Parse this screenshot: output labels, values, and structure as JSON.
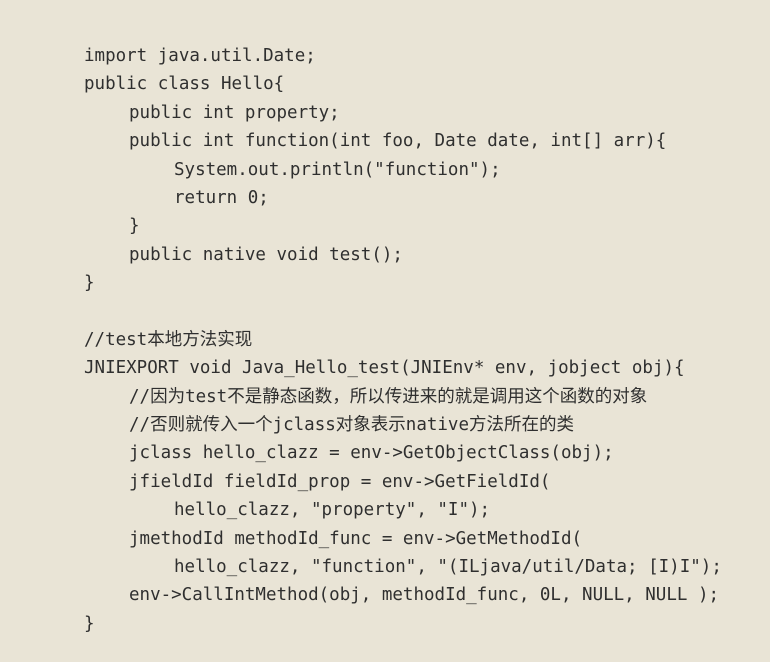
{
  "code_block": {
    "lines": [
      {
        "text": "import java.util.Date;",
        "indent": 0
      },
      {
        "text": "public class Hello{",
        "indent": 0
      },
      {
        "text": "public int property;",
        "indent": 1
      },
      {
        "text": "public int function(int foo, Date date, int[] arr){",
        "indent": 1
      },
      {
        "text": "System.out.println(\"function\");",
        "indent": 2
      },
      {
        "text": "return 0;",
        "indent": 2
      },
      {
        "text": "}",
        "indent": 1
      },
      {
        "text": "public native void test();",
        "indent": 1
      },
      {
        "text": "}",
        "indent": 0
      },
      {
        "text": "",
        "indent": 0
      },
      {
        "text": "//test本地方法实现",
        "indent": 0
      },
      {
        "text": "JNIEXPORT void Java_Hello_test(JNIEnv* env, jobject obj){",
        "indent": 0
      },
      {
        "text": "//因为test不是静态函数，所以传进来的就是调用这个函数的对象",
        "indent": 1
      },
      {
        "text": "//否则就传入一个jclass对象表示native方法所在的类",
        "indent": 1
      },
      {
        "text": "jclass hello_clazz = env->GetObjectClass(obj);",
        "indent": 1
      },
      {
        "text": "jfieldId fieldId_prop = env->GetFieldId(",
        "indent": 1
      },
      {
        "text": "hello_clazz, \"property\", \"I\");",
        "indent": 2
      },
      {
        "text": "jmethodId methodId_func = env->GetMethodId(",
        "indent": 1
      },
      {
        "text": "hello_clazz, \"function\", \"(ILjava/util/Data; [I)I\");",
        "indent": 2
      },
      {
        "text": "env->CallIntMethod(obj, methodId_func, 0L, NULL, NULL );",
        "indent": 1
      },
      {
        "text": "}",
        "indent": 0
      }
    ]
  }
}
